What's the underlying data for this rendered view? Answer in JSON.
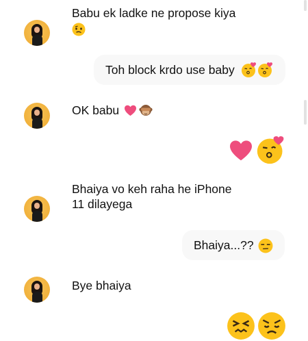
{
  "messages": [
    {
      "sender": "them",
      "text": "Babu ek ladke ne propose kiya",
      "emoji": [
        "confused-face"
      ]
    },
    {
      "sender": "me",
      "text": "Toh block krdo use baby",
      "emoji": [
        "kissing-heart-face",
        "kissing-heart-face"
      ]
    },
    {
      "sender": "them",
      "text": "OK babu",
      "emoji": [
        "pink-heart",
        "see-no-evil-monkey"
      ]
    },
    {
      "sender": "me",
      "text": "",
      "emoji": [
        "pink-heart",
        "kissing-heart-face"
      ]
    },
    {
      "sender": "them",
      "text_line1": "Bhaiya vo keh raha he iPhone",
      "text_line2": "11 dilayega",
      "emoji": []
    },
    {
      "sender": "me",
      "text": "Bhaiya...??",
      "emoji": [
        "unamused-face"
      ]
    },
    {
      "sender": "them",
      "text": "Bye bhaiya",
      "emoji": []
    },
    {
      "sender": "me",
      "text": "",
      "emoji": [
        "persevering-face",
        "confounded-face"
      ]
    }
  ],
  "colors": {
    "background": "#ffffff",
    "bubble": "#f8f8f8",
    "text": "#111111",
    "heart": "#ee4d7d",
    "emoji_yellow": "#fcc21b"
  }
}
